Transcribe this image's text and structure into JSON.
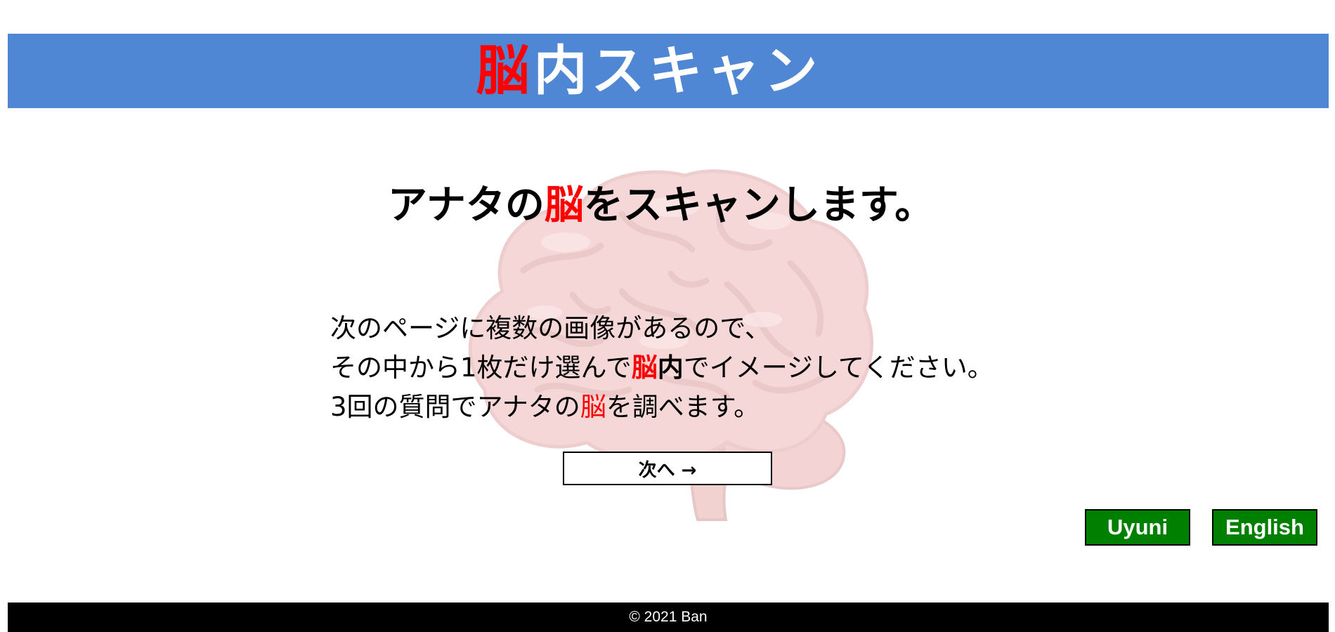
{
  "header": {
    "title_part1": "脳",
    "title_part2": "内スキャン"
  },
  "main": {
    "headline": {
      "part1": "アナタの",
      "part2": "脳",
      "part3": "をスキャンします。"
    },
    "body": {
      "line1": "次のページに複数の画像があるので、",
      "line2_a": "その中から1枚だけ選んで",
      "line2_b": "脳",
      "line2_c": "内",
      "line2_d": "でイメージしてください。",
      "line3_a": "3回の質問でアナタの",
      "line3_b": "脳",
      "line3_c": "を調べます。"
    },
    "next_button": "次へ →",
    "background_image": "brain-illustration"
  },
  "language_buttons": {
    "uyuni": "Uyuni",
    "english": "English"
  },
  "footer": {
    "copyright": "© 2021 Ban"
  },
  "colors": {
    "header_bg": "#4f87d4",
    "accent_red": "#ff0000",
    "button_green": "#008000",
    "footer_bg": "#000000",
    "brain_pink": "#f2b3b3"
  }
}
